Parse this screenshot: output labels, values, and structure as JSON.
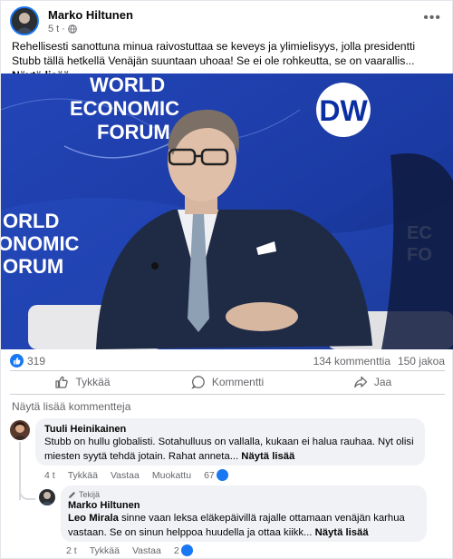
{
  "post": {
    "author": "Marko Hiltunen",
    "time": "5 t",
    "text": "Rehellisesti sanottuna minua raivostuttaa se keveys ja ylimielisyys, jolla presidentti Stubb tällä hetkellä Venäjän suuntaan uhoaa! Se ei ole rohkeutta, se on vaarallis...",
    "see_more": "Näytä lisää"
  },
  "image": {
    "banner_top": [
      "WORLD",
      "ECONOMIC",
      "FORUM"
    ],
    "banner_left": [
      "ORLD",
      "ONOMIC",
      "ORUM"
    ],
    "banner_right": [
      "EC",
      "FO"
    ],
    "logo": "DW"
  },
  "stats": {
    "reactions": "319",
    "comments": "134 kommenttia",
    "shares": "150 jakoa"
  },
  "actions": {
    "like": "Tykkää",
    "comment": "Kommentti",
    "share": "Jaa"
  },
  "more_comments": "Näytä lisää kommentteja",
  "comments": [
    {
      "author": "Tuuli Heinikainen",
      "text": "Stubb on hullu globalisti. Sotahulluus on vallalla, kukaan ei halua rauhaa. Nyt olisi miesten syytä tehdä jotain. Rahat anneta...",
      "see_more": "Näytä lisää",
      "time": "4 t",
      "like": "Tykkää",
      "reply": "Vastaa",
      "edited": "Muokattu",
      "reactions": "67"
    },
    {
      "badge": "Tekijä",
      "author": "Marko Hiltunen",
      "mention": "Leo Mirala",
      "text": " sinne vaan leksa eläkepäivillä rajalle ottamaan venäjän karhua vastaan. Se on sinun helppoa huudella ja ottaa kiikk...",
      "see_more": "Näytä lisää",
      "time": "2 t",
      "like": "Tykkää",
      "reply": "Vastaa",
      "reactions": "2"
    }
  ],
  "colors": {
    "accent": "#1877f2",
    "muted": "#65676b",
    "bubble": "#f0f2f5",
    "wef_blue": "#1a3a9e"
  }
}
